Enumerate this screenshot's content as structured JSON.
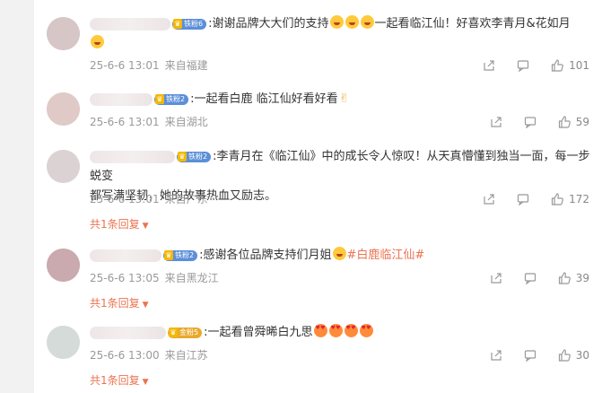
{
  "comments": [
    {
      "badge": "铁粉6",
      "badge_tone": "blue",
      "text_parts": [
        "谢谢品牌大大们的支持",
        "一起看临江仙！好喜欢李青月&花如月"
      ],
      "date": "25-6-6 13:01",
      "location": "来自福建",
      "likes": "101",
      "reply": ""
    },
    {
      "badge": "铁粉2",
      "badge_tone": "blue",
      "text_parts": [
        "一起看白鹿 临江仙好看好看"
      ],
      "date": "25-6-6 13:01",
      "location": "来自湖北",
      "likes": "59",
      "reply": ""
    },
    {
      "badge": "铁粉2",
      "badge_tone": "blue",
      "text_parts": [
        "李青月在《临江仙》中的成长令人惊叹！从天真懵懂到独当一面，每一步蜕变",
        "都写满坚韧，她的故事热血又励志。"
      ],
      "date": "25-6-6 13:01",
      "location": "来自广东",
      "likes": "172",
      "reply": "共1条回复"
    },
    {
      "badge": "铁粉2",
      "badge_tone": "blue",
      "text_parts": [
        "感谢各位品牌支持们月姐"
      ],
      "hashtag": "#白鹿临江仙#",
      "date": "25-6-6 13:05",
      "location": "来自黑龙江",
      "likes": "39",
      "reply": "共1条回复"
    },
    {
      "badge": "金粉5",
      "badge_tone": "gold",
      "text_parts": [
        "一起看曾舜晞白九思"
      ],
      "date": "25-6-6 13:00",
      "location": "来自江苏",
      "likes": "30",
      "reply": "共1条回复"
    }
  ],
  "separator": ":",
  "icons": {
    "share": "share-icon",
    "comment": "comment-icon",
    "like": "thumbs-up-icon",
    "reply_caret": "caret-down-icon"
  },
  "colors": {
    "accent": "#eb7350",
    "meta": "#999999",
    "badge_blue": "#5b8fd8",
    "badge_gold": "#e8a92c"
  }
}
